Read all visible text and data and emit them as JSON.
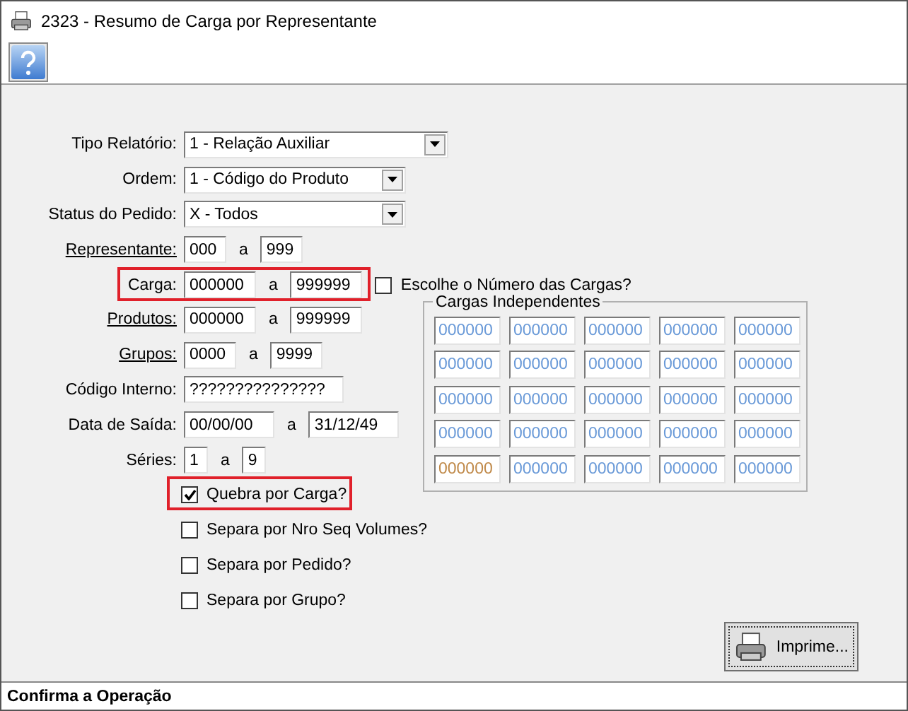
{
  "window": {
    "title": "2323 - Resumo de Carga por Representante"
  },
  "form": {
    "rows": [
      {
        "kind": "combo",
        "label": "Tipo Relatório:",
        "underlined": false,
        "highlighted": false,
        "value": "1 - Relação Auxiliar"
      },
      {
        "kind": "combo",
        "label": "Ordem:",
        "underlined": false,
        "highlighted": false,
        "value": "1 - Código do Produto"
      },
      {
        "kind": "combo",
        "label": "Status do Pedido:",
        "underlined": false,
        "highlighted": false,
        "value": "X - Todos"
      },
      {
        "kind": "range",
        "label": "Representante:",
        "underlined": true,
        "highlighted": false,
        "from": "000",
        "separator": "a",
        "to": "999"
      },
      {
        "kind": "range",
        "label": "Carga:",
        "underlined": false,
        "highlighted": true,
        "from": "000000",
        "separator": "a",
        "to": "999999",
        "option": {
          "label": "Escolhe o Número das Cargas?",
          "checked": false
        }
      },
      {
        "kind": "range",
        "label": "Produtos:",
        "underlined": true,
        "highlighted": false,
        "from": "000000",
        "separator": "a",
        "to": "999999"
      },
      {
        "kind": "range",
        "label": "Grupos:",
        "underlined": true,
        "highlighted": false,
        "from": "0000",
        "separator": "a",
        "to": "9999"
      },
      {
        "kind": "text",
        "label": "Código Interno:",
        "underlined": false,
        "highlighted": false,
        "value": "???????????????"
      },
      {
        "kind": "range",
        "label": "Data de Saída:",
        "underlined": false,
        "highlighted": false,
        "from": "00/00/00",
        "separator": "a",
        "to": "31/12/49"
      },
      {
        "kind": "range",
        "label": "Séries:",
        "underlined": false,
        "highlighted": false,
        "from": "1",
        "separator": "a",
        "to": "9"
      }
    ]
  },
  "cargas_independentes": {
    "title": "Cargas Independentes",
    "rows": [
      [
        {
          "value": "000000",
          "color": "#6a9ad8"
        },
        {
          "value": "000000",
          "color": "#6a9ad8"
        },
        {
          "value": "000000",
          "color": "#6a9ad8"
        },
        {
          "value": "000000",
          "color": "#6a9ad8"
        },
        {
          "value": "000000",
          "color": "#6a9ad8"
        }
      ],
      [
        {
          "value": "000000",
          "color": "#6a9ad8"
        },
        {
          "value": "000000",
          "color": "#6a9ad8"
        },
        {
          "value": "000000",
          "color": "#6a9ad8"
        },
        {
          "value": "000000",
          "color": "#6a9ad8"
        },
        {
          "value": "000000",
          "color": "#6a9ad8"
        }
      ],
      [
        {
          "value": "000000",
          "color": "#6a9ad8"
        },
        {
          "value": "000000",
          "color": "#6a9ad8"
        },
        {
          "value": "000000",
          "color": "#6a9ad8"
        },
        {
          "value": "000000",
          "color": "#6a9ad8"
        },
        {
          "value": "000000",
          "color": "#6a9ad8"
        }
      ],
      [
        {
          "value": "000000",
          "color": "#6a9ad8"
        },
        {
          "value": "000000",
          "color": "#6a9ad8"
        },
        {
          "value": "000000",
          "color": "#6a9ad8"
        },
        {
          "value": "000000",
          "color": "#6a9ad8"
        },
        {
          "value": "000000",
          "color": "#6a9ad8"
        }
      ],
      [
        {
          "value": "000000",
          "color": "#c08a4a"
        },
        {
          "value": "000000",
          "color": "#6a9ad8"
        },
        {
          "value": "000000",
          "color": "#6a9ad8"
        },
        {
          "value": "000000",
          "color": "#6a9ad8"
        },
        {
          "value": "000000",
          "color": "#6a9ad8"
        }
      ]
    ]
  },
  "options": [
    {
      "label": "Quebra por Carga?",
      "checked": true,
      "highlighted": true
    },
    {
      "label": "Separa por Nro Seq Volumes?",
      "checked": false,
      "highlighted": false
    },
    {
      "label": "Separa por Pedido?",
      "checked": false,
      "highlighted": false
    },
    {
      "label": "Separa por Grupo?",
      "checked": false,
      "highlighted": false
    }
  ],
  "print_button": "Imprime...",
  "status_bar": "Confirma a Operação"
}
